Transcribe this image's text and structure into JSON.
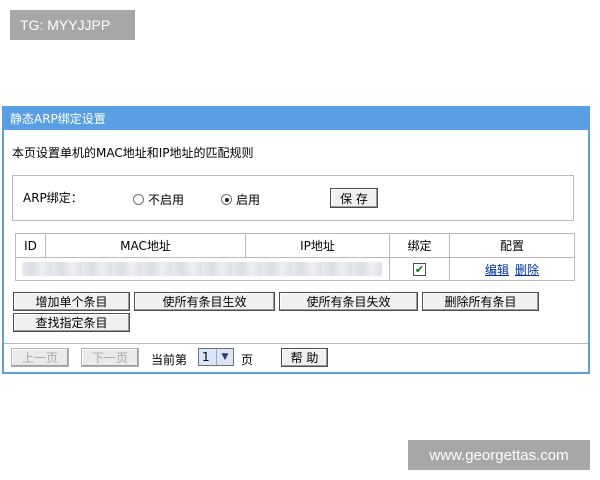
{
  "watermarks": {
    "top_left": "TG: MYYJJPP",
    "bottom_right": "www.georgettas.com"
  },
  "panel": {
    "title": "静态ARP绑定设置",
    "description": "本页设置单机的MAC地址和IP地址的匹配规则"
  },
  "arp": {
    "label": "ARP绑定：",
    "options": [
      {
        "label": "不启用",
        "selected": false
      },
      {
        "label": "启用",
        "selected": true
      }
    ],
    "save_label": "保 存"
  },
  "table": {
    "headers": [
      "ID",
      "MAC地址",
      "IP地址",
      "绑定",
      "配置"
    ],
    "rows": [
      {
        "bound": true,
        "edit_label": "编辑",
        "delete_label": "删除"
      }
    ]
  },
  "actions": {
    "add_label": "增加单个条目",
    "enable_all_label": "使所有条目生效",
    "disable_all_label": "使所有条目失效",
    "delete_all_label": "删除所有条目",
    "find_label": "查找指定条目"
  },
  "pager": {
    "prev_label": "上一页",
    "next_label": "下一页",
    "current_prefix": "当前第",
    "current_page": "1",
    "current_suffix": "页",
    "help_label": "帮 助"
  },
  "colors": {
    "titlebar": "#5a9fe4",
    "link": "#003399",
    "border": "#b9b9b9"
  }
}
